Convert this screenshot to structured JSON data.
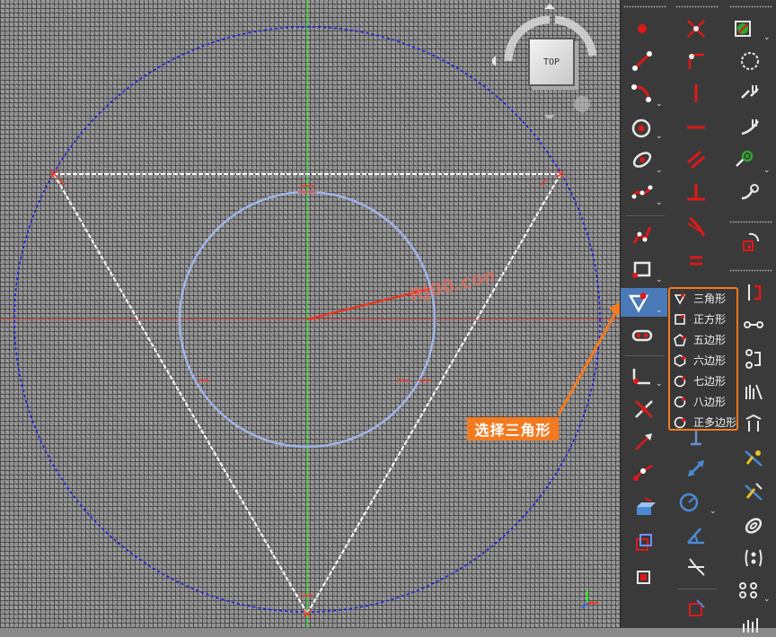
{
  "viewport": {
    "nav_cube_face": "TOP",
    "annotation_label": "选择三角形"
  },
  "colors": {
    "accent_orange": "#f47a20",
    "toolbar_bg": "#3a3a3a",
    "selection_blue": "#4a79b8",
    "construction_blue": "#1a1af0",
    "sketch_white": "#ffffff",
    "axis_green": "#22ff22",
    "axis_red": "#ff3030",
    "icon_red": "#e01818"
  },
  "toolbar": {
    "polygon_menu": {
      "items": [
        {
          "label": "三角形",
          "icon": "triangle-icon"
        },
        {
          "label": "正方形",
          "icon": "square-icon"
        },
        {
          "label": "五边形",
          "icon": "pentagon-icon"
        },
        {
          "label": "六边形",
          "icon": "hexagon-icon"
        },
        {
          "label": "七边形",
          "icon": "heptagon-icon"
        },
        {
          "label": "八边形",
          "icon": "octagon-icon"
        },
        {
          "label": "正多边形",
          "icon": "regular-polygon-icon"
        }
      ]
    }
  }
}
